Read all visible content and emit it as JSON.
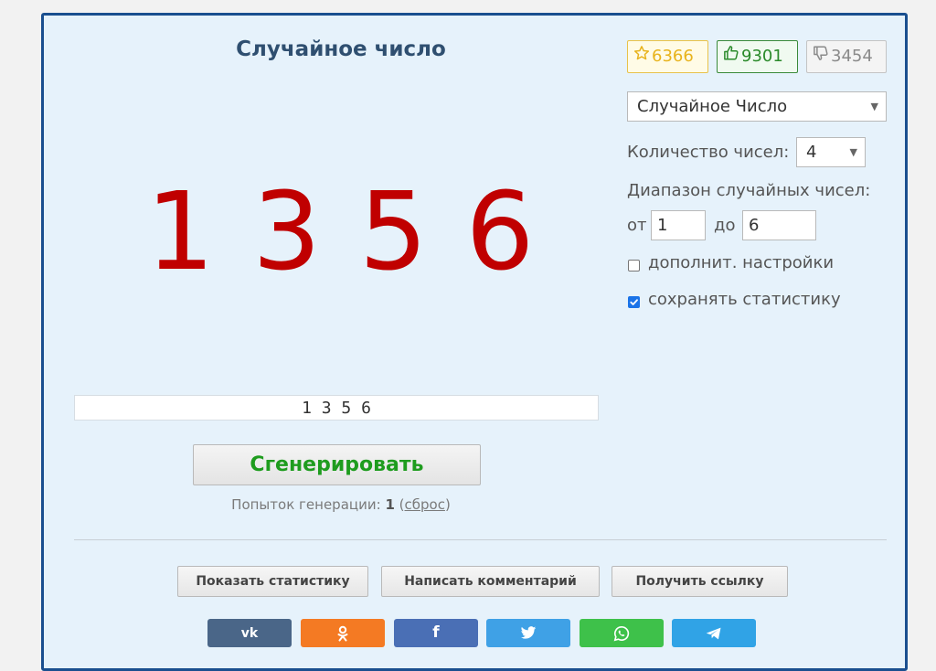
{
  "title": "Случайное число",
  "result": {
    "big": "1 3 5 6",
    "line": "1 3 5 6"
  },
  "generate_label": "Сгенерировать",
  "attempts": {
    "label": "Попыток генерации:",
    "count": "1",
    "reset_label": "сброс"
  },
  "actions": {
    "show_stats": "Показать статистику",
    "write_comment": "Написать комментарий",
    "get_link": "Получить ссылку"
  },
  "social": [
    {
      "name": "vk",
      "glyph": "vk",
      "color": "#4a6688"
    },
    {
      "name": "odnoklassniki",
      "glyph": "ok",
      "color": "#f47a23"
    },
    {
      "name": "facebook",
      "glyph": "f",
      "color": "#4a6fb5"
    },
    {
      "name": "twitter",
      "glyph": "tw",
      "color": "#3fa1e6"
    },
    {
      "name": "whatsapp",
      "glyph": "wa",
      "color": "#3ec14a"
    },
    {
      "name": "telegram",
      "glyph": "tg",
      "color": "#30a3e6"
    }
  ],
  "ratings": {
    "favorites": "6366",
    "likes": "9301",
    "dislikes": "3454",
    "favorites_color": "#e8b31c",
    "likes_color": "#2a8a2a",
    "dislikes_color": "#8a8a8a"
  },
  "settings": {
    "generator_select": "Случайное Число",
    "count_label": "Количество чисел:",
    "count_value": "4",
    "range_label": "Диапазон случайных чисел:",
    "from_label": "от",
    "from_value": "1",
    "to_label": "до",
    "to_value": "6",
    "advanced_label": "дополнит. настройки",
    "advanced_checked": false,
    "save_stats_label": "сохранять статистику",
    "save_stats_checked": true
  }
}
